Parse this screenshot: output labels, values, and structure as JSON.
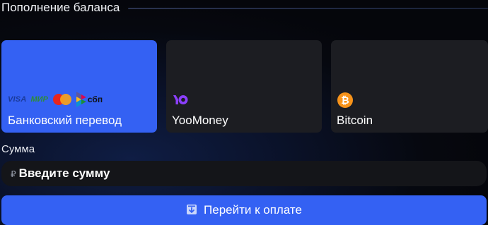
{
  "header": {
    "title": "Пополнение баланса"
  },
  "methods": [
    {
      "label": "Банковский перевод",
      "active": true,
      "logos": {
        "visa": "VISA",
        "mir": "МИР",
        "sbp": "сбп"
      }
    },
    {
      "label": "YooMoney",
      "active": false,
      "icon": "yoomoney-icon"
    },
    {
      "label": "Bitcoin",
      "active": false,
      "icon": "bitcoin-icon"
    }
  ],
  "amount": {
    "label": "Сумма",
    "currency_symbol": "₽",
    "placeholder": "Введите сумму",
    "value": ""
  },
  "pay_button": {
    "label": "Перейти к оплате",
    "icon": "download-icon"
  },
  "colors": {
    "accent": "#3461f3",
    "card": "#1c1d22",
    "input": "#141519",
    "yoomoney": "#8b3ffd",
    "bitcoin": "#f7931a"
  }
}
